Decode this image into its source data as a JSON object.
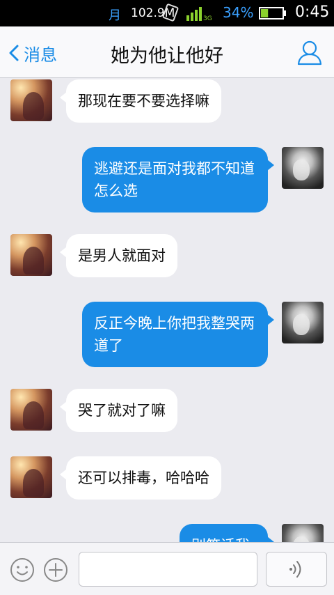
{
  "status_bar": {
    "moon_glyph": "月",
    "speed": "102.9M",
    "network": "3G",
    "battery_percent": "34%",
    "battery_level": 0.34,
    "time": "0:45"
  },
  "header": {
    "back_label": "消息",
    "title": "她为他让他好"
  },
  "messages": [
    {
      "side": "left",
      "text": "那现在要不要选择嘛"
    },
    {
      "side": "right",
      "text": "逃避还是面对我都不知道怎么选"
    },
    {
      "side": "left",
      "text": "是男人就面对"
    },
    {
      "side": "right",
      "text": "反正今晚上你把我整哭两道了"
    },
    {
      "side": "left",
      "text": "哭了就对了嘛"
    },
    {
      "side": "left",
      "text": "还可以排毒，哈哈哈"
    },
    {
      "side": "right",
      "text": "别笑话我"
    }
  ],
  "input_bar": {
    "placeholder": ""
  },
  "colors": {
    "accent": "#1a8ce6",
    "background": "#ebebf0",
    "left_bubble": "#ffffff"
  },
  "icons": [
    "back-chevron-icon",
    "profile-icon",
    "emoji-icon",
    "plus-icon",
    "voice-icon"
  ]
}
